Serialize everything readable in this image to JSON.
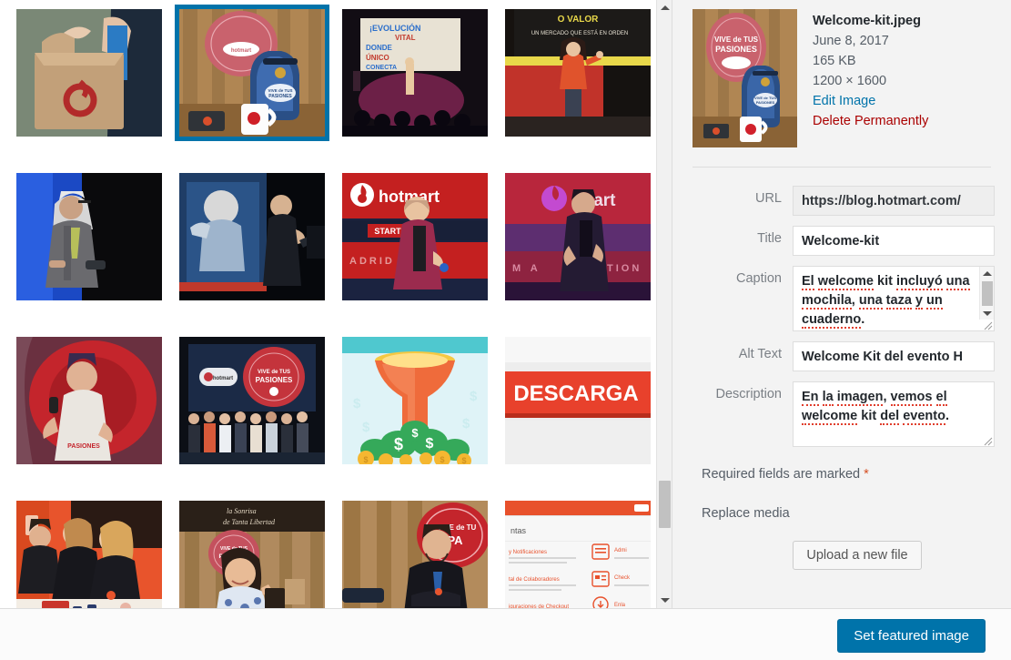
{
  "attachment": {
    "filename": "Welcome-kit.jpeg",
    "date": "June 8, 2017",
    "filesize": "165 KB",
    "dimensions": "1200 × 1600",
    "edit_label": "Edit Image",
    "delete_label": "Delete Permanently"
  },
  "form": {
    "url": {
      "label": "URL",
      "value": "https://blog.hotmart.com/"
    },
    "title": {
      "label": "Title",
      "value": "Welcome-kit"
    },
    "caption": {
      "label": "Caption",
      "value": "El welcome kit incluyó una mochila, una taza y un cuaderno."
    },
    "alt": {
      "label": "Alt Text",
      "value": "Welcome Kit del evento H"
    },
    "description": {
      "label": "Description",
      "value": "En la imagen, vemos el welcome kit del evento."
    }
  },
  "notes": {
    "required": "Required fields are marked",
    "required_star": "*",
    "replace_media": "Replace media"
  },
  "buttons": {
    "upload": "Upload a new file",
    "set_featured": "Set featured image"
  },
  "colors": {
    "accent": "#0073aa",
    "danger": "#a00",
    "required_star": "#d54e21",
    "panel_bg": "#f3f3f3"
  },
  "grid": {
    "columns": 4,
    "selected_index": 1,
    "items": [
      {
        "name": "brown-paper-bag-hotmart-logo",
        "alt": "Person holding brown paper bag with red Hotmart flame logo"
      },
      {
        "name": "welcome-kit-backpack-mug",
        "alt": "Blue Hotmart backpack and white mug on wooden table with Vive de tus Pasiones sign",
        "selected": true
      },
      {
        "name": "stage-speaker-audience",
        "alt": "Speaker on stage in front of seated audience with projected slides"
      },
      {
        "name": "woman-speaker-orange-shirt",
        "alt": "Woman in orange shirt presenting on stage with yellow and red backdrop"
      },
      {
        "name": "older-man-speaker-blue-stage",
        "alt": "Older man in grey suit speaking with blue stage lighting"
      },
      {
        "name": "bald-speaker-podium",
        "alt": "Bald speaker at podium with his portrait projected behind him"
      },
      {
        "name": "hotmart-start-madrid-speaker",
        "alt": "Speaker in red jacket in front of Hotmart START Madrid backdrop"
      },
      {
        "name": "hotmart-purple-stage-speaker",
        "alt": "Speaker in dark jacket in front of purple Hotmart backdrop"
      },
      {
        "name": "speaker-white-tshirt-red-backdrop",
        "alt": "Speaker in white t-shirt gesturing in front of red backdrop"
      },
      {
        "name": "group-photo-stage",
        "alt": "Group photo of team on stage with Vive de tus Pasiones screen"
      },
      {
        "name": "sales-funnel-money-illustration",
        "alt": "Illustration of orange funnel pouring into pile of green money bags and coins"
      },
      {
        "name": "descargar-button-graphic",
        "alt": "Red DESCARGAR download button graphic on grey background"
      },
      {
        "name": "staff-packing-kits",
        "alt": "Staff members packing event kits at a table"
      },
      {
        "name": "woman-smiling-wooden-wall",
        "alt": "Smiling woman in floral top in front of wooden wall with Vive de tus Pasiones sign"
      },
      {
        "name": "man-crossed-arms-wooden-wall",
        "alt": "Man with crossed arms in front of wooden wall with Vive de tus Pasiones sign"
      },
      {
        "name": "hotmart-dashboard-screenshot",
        "alt": "Screenshot of Hotmart account dashboard with orange icons and menu cards"
      }
    ]
  }
}
